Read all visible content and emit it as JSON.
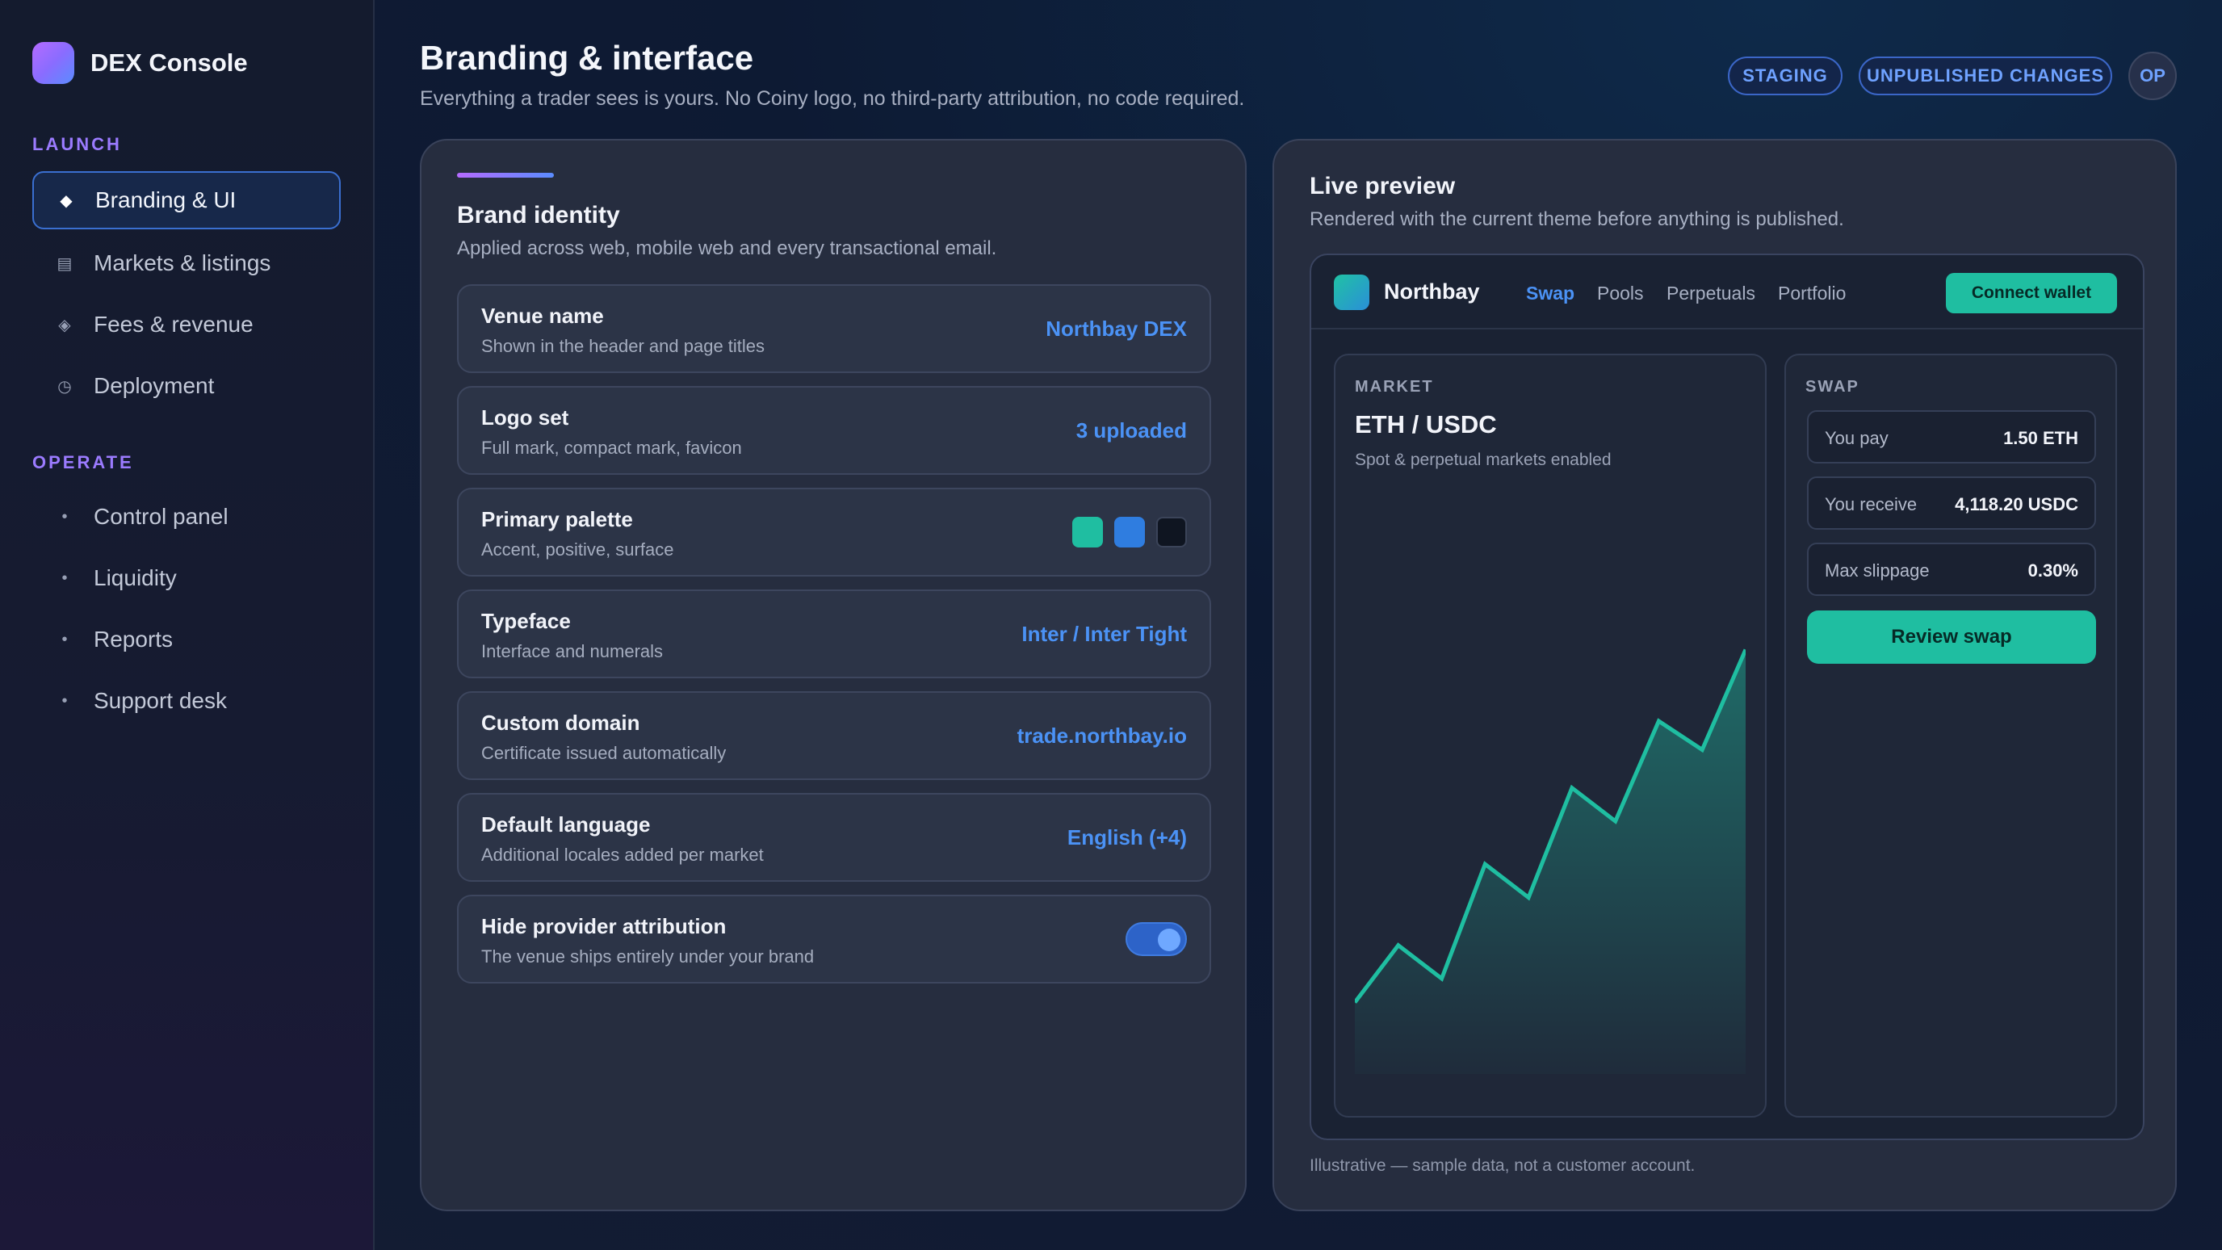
{
  "app": {
    "name": "DEX Console"
  },
  "sidebar": {
    "launch_label": "LAUNCH",
    "launch_items": [
      {
        "label": "Branding & UI",
        "icon": "diamond-icon",
        "glyph": "◆",
        "active": true
      },
      {
        "label": "Markets & listings",
        "icon": "list-icon",
        "glyph": "▤"
      },
      {
        "label": "Fees & revenue",
        "icon": "diamond-outline-icon",
        "glyph": "◈"
      },
      {
        "label": "Deployment",
        "icon": "clock-icon",
        "glyph": "◷"
      }
    ],
    "operate_label": "OPERATE",
    "operate_items": [
      {
        "label": "Control panel",
        "glyph": "•"
      },
      {
        "label": "Liquidity",
        "glyph": "•"
      },
      {
        "label": "Reports",
        "glyph": "•"
      },
      {
        "label": "Support desk",
        "glyph": "•"
      }
    ]
  },
  "header": {
    "title": "Branding & interface",
    "subtitle": "Everything a trader sees is yours. No Coiny logo, no third-party attribution, no code required.",
    "badges": [
      "STAGING",
      "UNPUBLISHED CHANGES"
    ],
    "avatar": "OP"
  },
  "brand_identity": {
    "title": "Brand identity",
    "subtitle": "Applied across web, mobile web and every transactional email.",
    "rows": [
      {
        "title": "Venue name",
        "desc": "Shown in the header and page titles",
        "value": "Northbay DEX"
      },
      {
        "title": "Logo set",
        "desc": "Full mark, compact mark, favicon",
        "value": "3 uploaded"
      },
      {
        "title": "Primary palette",
        "desc": "Accent, positive, surface",
        "swatches": [
          "#1fbea1",
          "#2f7de0",
          "#0f1521"
        ]
      },
      {
        "title": "Typeface",
        "desc": "Interface and numerals",
        "value": "Inter / Inter Tight"
      },
      {
        "title": "Custom domain",
        "desc": "Certificate issued automatically",
        "value": "trade.northbay.io"
      },
      {
        "title": "Default language",
        "desc": "Additional locales added per market",
        "value": "English (+4)"
      },
      {
        "title": "Hide provider attribution",
        "desc": "The venue ships entirely under your brand",
        "toggle_on": true
      }
    ]
  },
  "preview": {
    "title": "Live preview",
    "subtitle": "Rendered with the current theme before anything is published.",
    "app_brand": "Northbay",
    "nav": [
      "Swap",
      "Pools",
      "Perpetuals",
      "Portfolio"
    ],
    "connect_label": "Connect wallet",
    "market": {
      "label": "MARKET",
      "pair": "ETH / USDC",
      "subtitle": "Spot & perpetual markets enabled"
    },
    "swap": {
      "label": "SWAP",
      "fields": [
        {
          "label": "You pay",
          "value": "1.50 ETH"
        },
        {
          "label": "You receive",
          "value": "4,118.20 USDC"
        },
        {
          "label": "Max slippage",
          "value": "0.30%"
        }
      ],
      "button": "Review swap"
    },
    "footnote": "Illustrative — sample data, not a customer account."
  },
  "chart_data": {
    "type": "area",
    "x": [
      0,
      1,
      2,
      3,
      4,
      5,
      6,
      7,
      8,
      9
    ],
    "values": [
      0,
      12,
      5,
      29,
      22,
      45,
      38,
      59,
      53,
      74
    ],
    "ylim": [
      -15,
      90
    ],
    "color": "#1fbea1"
  }
}
